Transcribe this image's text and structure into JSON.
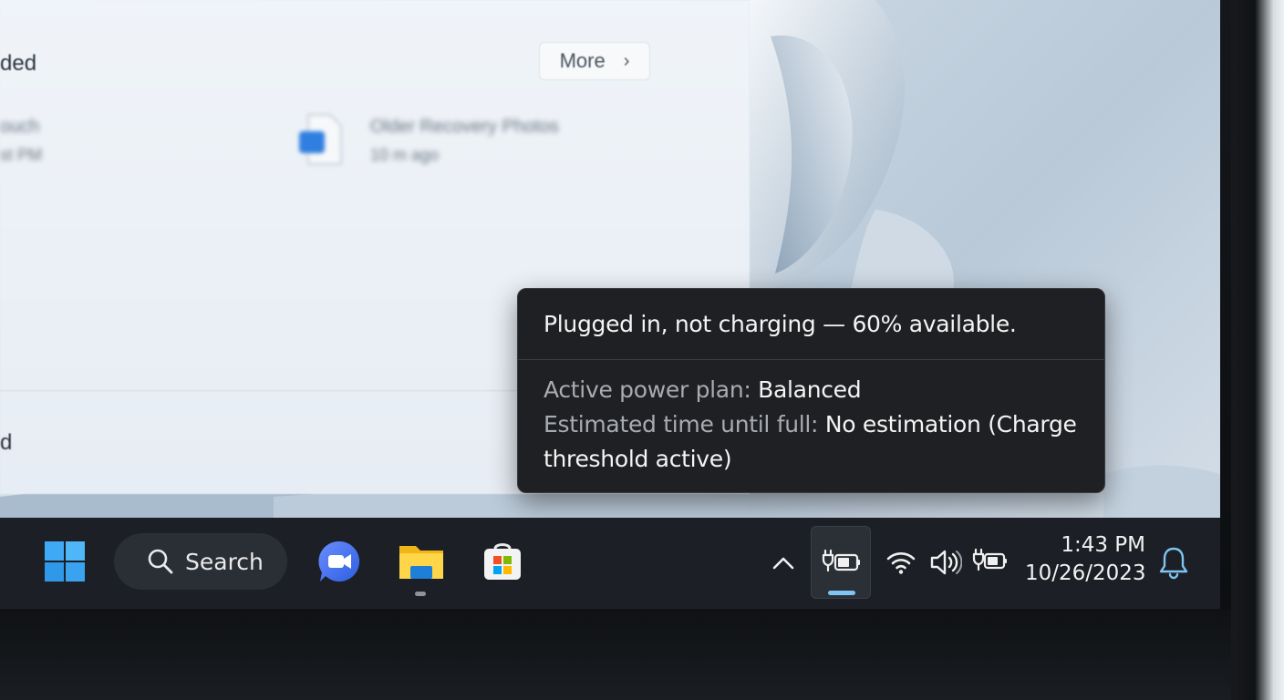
{
  "window": {
    "section_title": "ded",
    "more_label": "More",
    "recent_items": [
      {
        "name": "Older Recovery Photos",
        "meta": "10 m ago"
      },
      {
        "name": "ouch",
        "meta": "st PM"
      }
    ],
    "footer_label": "d"
  },
  "tooltip": {
    "headline": "Plugged in, not charging — 60% available.",
    "power_plan_label": "Active power plan:",
    "power_plan_value": "Balanced",
    "estimate_label": "Estimated time until full:",
    "estimate_value_line1": "No estimation (Charge",
    "estimate_value_line2": "threshold active)"
  },
  "taskbar": {
    "search_label": "Search",
    "icons": [
      "windows-start-icon",
      "search-icon",
      "video-meeting-icon",
      "file-explorer-icon",
      "store-icon",
      "chevron-up-icon",
      "battery-plugged-icon",
      "wifi-icon",
      "volume-icon",
      "battery-plugged-icon",
      "bell-icon"
    ],
    "time": "1:43 PM",
    "date": "10/26/2023"
  },
  "colors": {
    "taskbar_bg": "#1c2026",
    "tooltip_bg": "#1f2023",
    "accent": "#7fc4f2",
    "start_blue": "#3fa9f5"
  }
}
